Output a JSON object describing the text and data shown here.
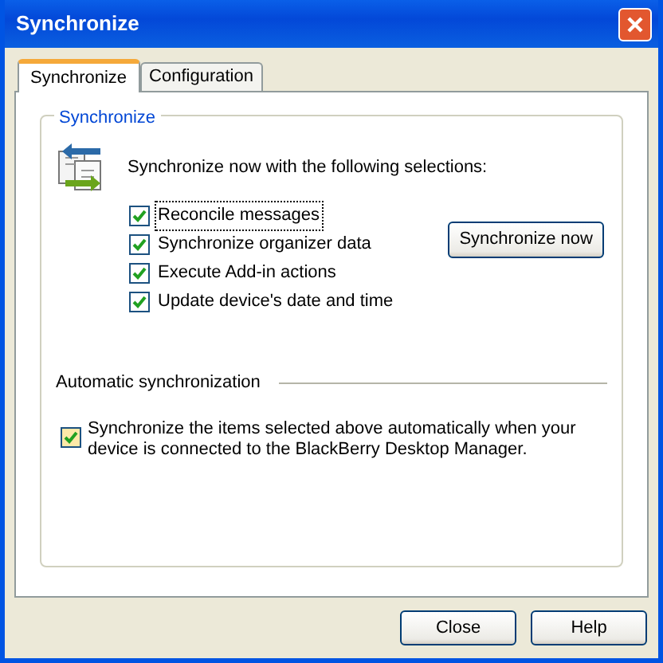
{
  "window": {
    "title": "Synchronize"
  },
  "tabs": [
    {
      "label": "Synchronize",
      "selected": true
    },
    {
      "label": "Configuration",
      "selected": false
    }
  ],
  "group": {
    "title": "Synchronize",
    "intro": "Synchronize now with the following selections:",
    "options": [
      {
        "label": "Reconcile messages",
        "checked": true,
        "focused": true
      },
      {
        "label": "Synchronize organizer data",
        "checked": true,
        "focused": false
      },
      {
        "label": "Execute Add-in actions",
        "checked": true,
        "focused": false
      },
      {
        "label": "Update device's date and time",
        "checked": true,
        "focused": false
      }
    ],
    "sync_button": "Synchronize now"
  },
  "automatic": {
    "title": "Automatic synchronization",
    "label": "Synchronize the items selected above automatically when your device is connected to the BlackBerry Desktop Manager.",
    "checked": true
  },
  "buttons": [
    "Close",
    "Help"
  ]
}
